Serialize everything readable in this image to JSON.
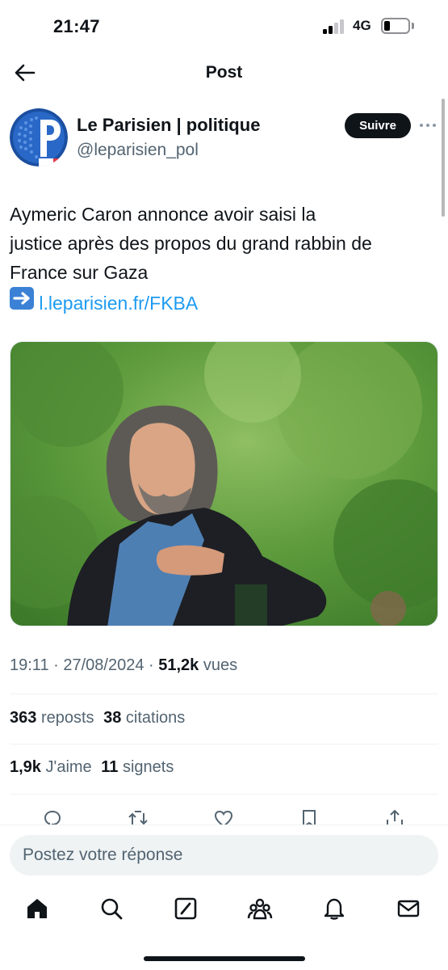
{
  "status_bar": {
    "time": "21:47",
    "network": "4G"
  },
  "header": {
    "title": "Post",
    "back_icon": "arrow-left-icon"
  },
  "author": {
    "name": "Le Parisien | politique",
    "handle": "@leparisien_pol",
    "follow_label": "Suivre",
    "more_icon": "more-dots-icon"
  },
  "tweet": {
    "text_lines": [
      "Aymeric Caron annonce avoir saisi la",
      "justice après des propos du grand rabbin de",
      "France sur Gaza"
    ],
    "link_emoji": "right-arrow-emoji-icon",
    "link": "l.leparisien.fr/FKBA"
  },
  "meta": {
    "time": "19:11",
    "sep1": " · ",
    "date": "27/08/2024",
    "sep2": " · ",
    "views_count": "51,2k",
    "views_label": "vues"
  },
  "stats": {
    "reposts_count": "363",
    "reposts_label": "reposts",
    "quotes_count": "38",
    "quotes_label": "citations",
    "likes_count": "1,9k",
    "likes_label": "J'aime",
    "bookmarks_count": "11",
    "bookmarks_label": "signets"
  },
  "reply": {
    "placeholder": "Postez votre réponse"
  },
  "tabs": [
    "home-icon",
    "search-icon",
    "grok-icon",
    "communities-icon",
    "notifications-icon",
    "messages-icon"
  ],
  "colors": {
    "link": "#1d9bf0",
    "text": "#0f1419",
    "secondary": "#536471",
    "follow_bg": "#0f1419"
  }
}
